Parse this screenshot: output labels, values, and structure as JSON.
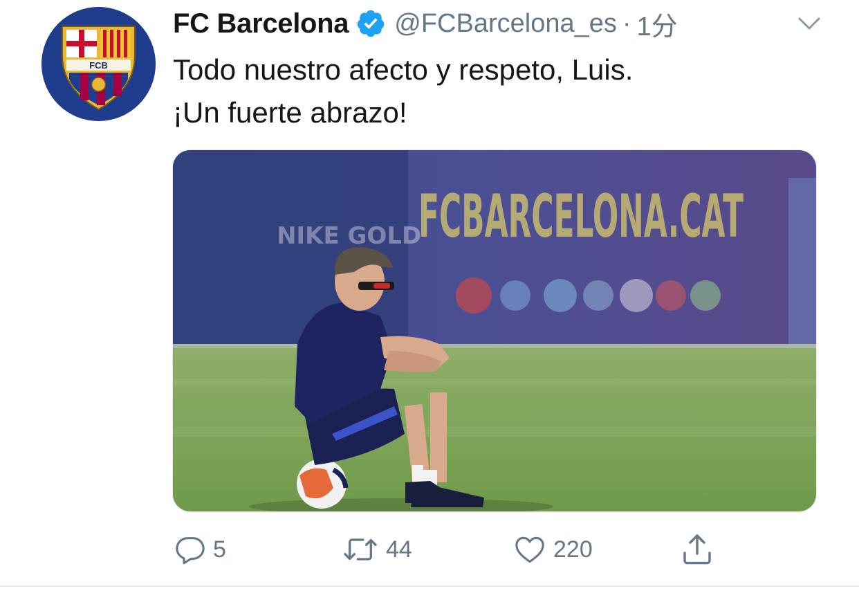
{
  "tweet": {
    "display_name": "FC Barcelona",
    "handle": "@FCBarcelona_es",
    "separator": "·",
    "time": "1分",
    "text_lines": [
      "Todo nuestro afecto y respeto, Luis.",
      "¡Un fuerte abrazo!"
    ],
    "avatar": {
      "icon": "fcb-crest-icon",
      "crest_letters": "FCB",
      "background_color": "#1f3d8c"
    },
    "verified_icon": "verified-badge-icon",
    "verified_color": "#1da1f2",
    "media": {
      "banner_text": "FCBARCELONA.CAT",
      "side_text": "NIKE GOLD"
    }
  },
  "actions": {
    "reply": {
      "icon": "reply-icon",
      "count": "5"
    },
    "retweet": {
      "icon": "retweet-icon",
      "count": "44"
    },
    "like": {
      "icon": "heart-icon",
      "count": "220"
    },
    "share": {
      "icon": "share-icon"
    }
  },
  "colors": {
    "text_primary": "#14171a",
    "text_secondary": "#657786",
    "accent": "#1da1f2"
  }
}
